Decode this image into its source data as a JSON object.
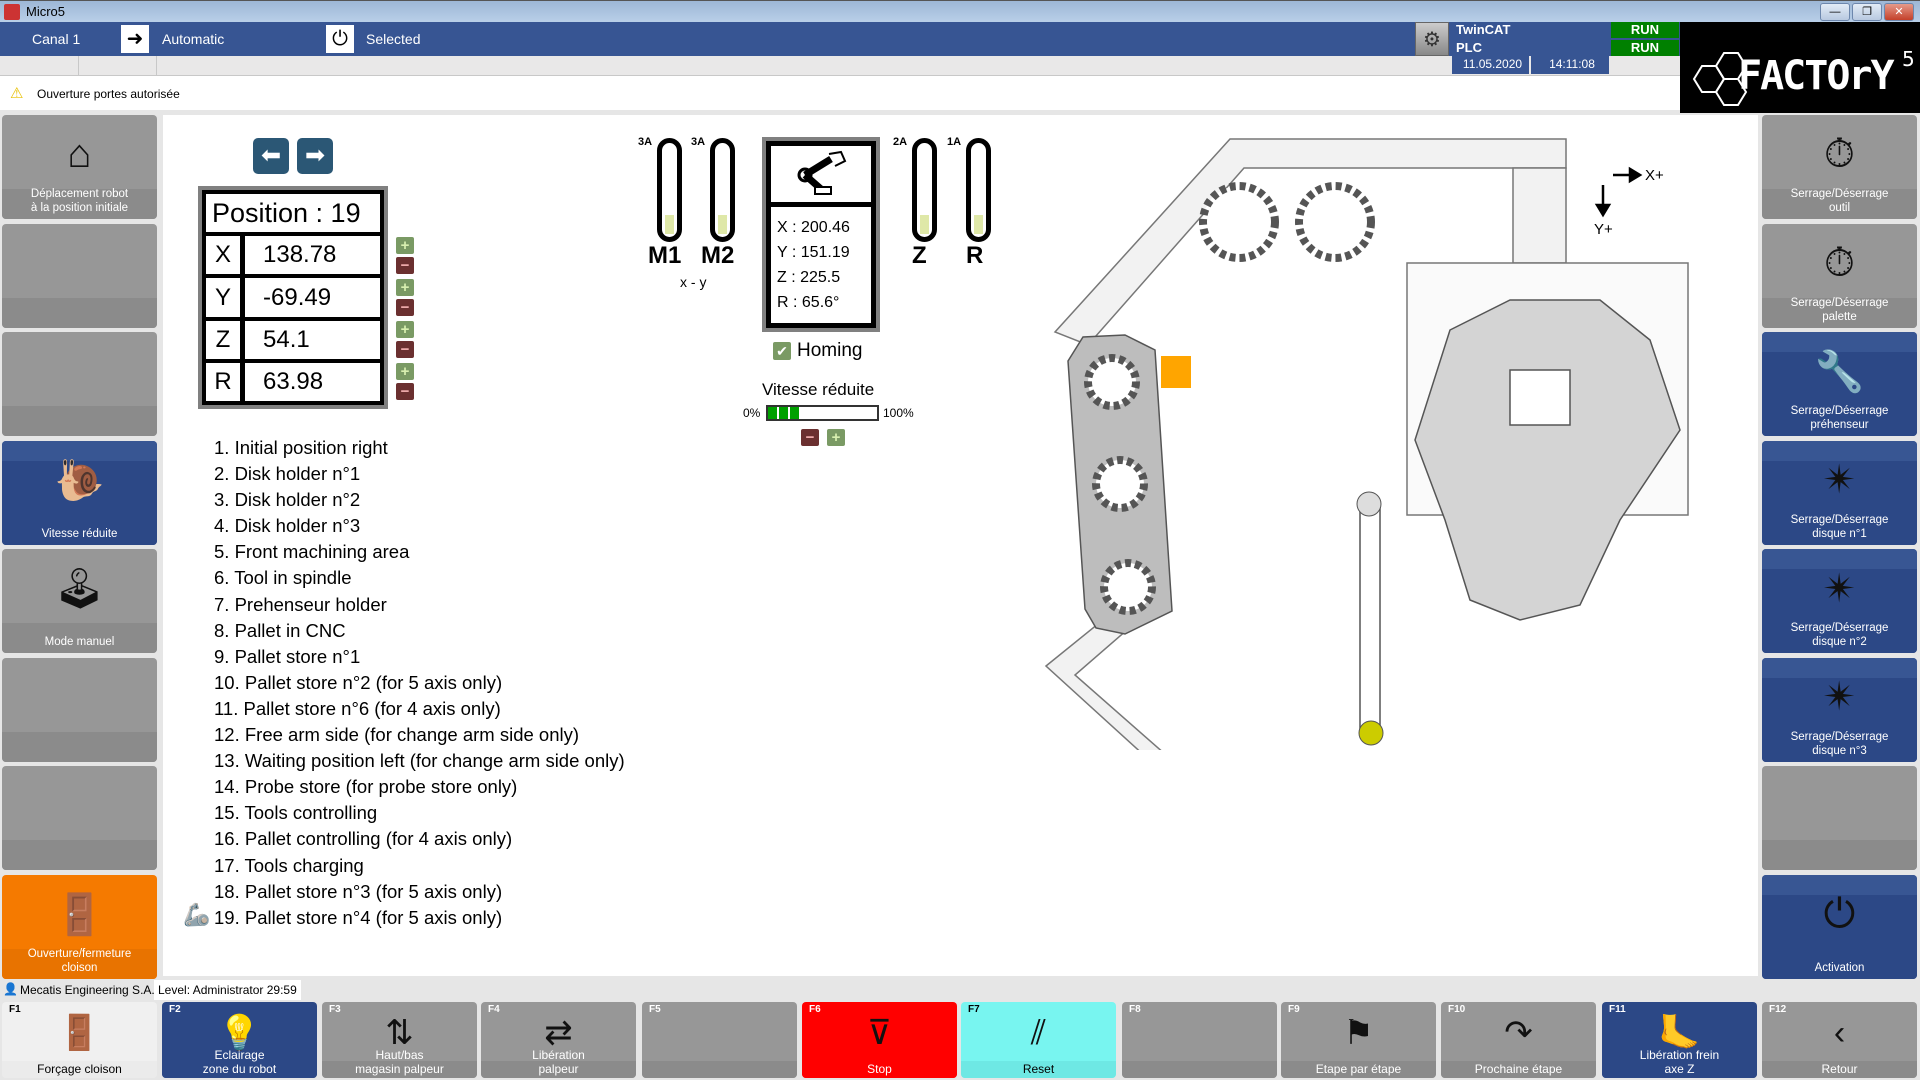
{
  "window": {
    "title": "Micro5",
    "controls": [
      "minimize",
      "restore",
      "close"
    ]
  },
  "topbar": {
    "channel": "Canal 1",
    "mode": "Automatic",
    "mode_icon": "enter-arrow-icon",
    "state": "Selected",
    "state_icon": "power-icon"
  },
  "plc_status": {
    "rows": [
      {
        "label": "TwinCAT",
        "status": "RUN"
      },
      {
        "label": "PLC",
        "status": "RUN"
      }
    ],
    "date": "11.05.2020",
    "time": "14:11:08",
    "status_color": "#008000"
  },
  "warning": {
    "text": "Ouverture portes autorisée",
    "icon": "warning-icon"
  },
  "logo": {
    "text": "FACTORY",
    "superscript": "5"
  },
  "left_sidebar": [
    {
      "label": "Déplacement robot\nà la position initiale",
      "icon": "home-arrows-icon",
      "style": "gray"
    },
    {
      "label": "",
      "icon": "",
      "style": "gray"
    },
    {
      "label": "",
      "icon": "",
      "style": "gray"
    },
    {
      "label": "Vitesse réduite",
      "icon": "snail-icon",
      "style": "blue"
    },
    {
      "label": "Mode manuel",
      "icon": "joystick-icon",
      "style": "gray"
    },
    {
      "label": "",
      "icon": "",
      "style": "gray"
    },
    {
      "label": "",
      "icon": "",
      "style": "gray"
    },
    {
      "label": "Ouverture/fermeture\ncloison",
      "icon": "door-icon",
      "style": "orange"
    }
  ],
  "right_sidebar": [
    {
      "label": "Serrage/Déserrage\noutil",
      "icon": "tool-clamp-timer-icon",
      "style": "gray"
    },
    {
      "label": "Serrage/Déserrage\npalette",
      "icon": "pallet-clamp-timer-icon",
      "style": "gray"
    },
    {
      "label": "Serrage/Déserrage\npréhenseur",
      "icon": "wrench-clamp-icon",
      "style": "blue"
    },
    {
      "label": "Serrage/Déserrage\ndisque n°1",
      "icon": "star-clamp-icon",
      "style": "blue"
    },
    {
      "label": "Serrage/Déserrage\ndisque n°2",
      "icon": "star-clamp-icon",
      "style": "blue"
    },
    {
      "label": "Serrage/Déserrage\ndisque n°3",
      "icon": "star-clamp-icon",
      "style": "blue"
    },
    {
      "label": "",
      "icon": "",
      "style": "gray"
    },
    {
      "label": "Activation",
      "icon": "power-icon",
      "style": "blue"
    }
  ],
  "position": {
    "title": "Position : 19",
    "axes": [
      {
        "name": "X",
        "value": "138.78"
      },
      {
        "name": "Y",
        "value": "-69.49"
      },
      {
        "name": "Z",
        "value": "54.1"
      },
      {
        "name": "R",
        "value": "63.98"
      }
    ]
  },
  "motors": [
    {
      "name": "M1",
      "current": "3A",
      "fill": 0.2
    },
    {
      "name": "M2",
      "current": "3A",
      "fill": 0.2
    },
    {
      "name": "Z",
      "current": "2A",
      "fill": 0.2
    },
    {
      "name": "R",
      "current": "1A",
      "fill": 0.2
    }
  ],
  "motors_caption": "x - y",
  "robot": {
    "icon": "robot-arm-icon",
    "coords": [
      "X : 200.46",
      "Y : 151.19",
      "Z : 225.5",
      "R : 65.6°"
    ],
    "homing_label": "Homing",
    "homing_checked": true
  },
  "speed": {
    "title": "Vitesse réduite",
    "min_label": "0%",
    "max_label": "100%",
    "value_percent": 30,
    "bar_color": "#00a000"
  },
  "positions_list": [
    "1. Initial position right",
    "2. Disk holder n°1",
    "3. Disk holder n°2",
    "4. Disk holder n°3",
    "5. Front machining area",
    "6. Tool in spindle",
    "7. Prehenseur holder",
    "8. Pallet in CNC",
    "9. Pallet store n°1",
    "10. Pallet store n°2 (for 5 axis only)",
    "11. Pallet store n°6 (for 4 axis only)",
    "12. Free arm side (for change arm side only)",
    "13. Waiting position left (for change arm side only)",
    "14. Probe store (for probe store only)",
    "15. Tools controlling",
    "16. Pallet controlling (for 4 axis only)",
    "17. Tools charging",
    "18. Pallet store n°3 (for 5 axis only)",
    "19. Pallet store n°4 (for 5 axis only)"
  ],
  "current_position_index": 19,
  "layout_view": {
    "x_axis_label": "X+",
    "y_axis_label": "Y+",
    "marker_color": "#ffa500",
    "carriage_color": "#cccc00"
  },
  "status": {
    "company": "Mecatis Engineering S.A.",
    "level": "Level: Administrator 29:59"
  },
  "fkeys": [
    {
      "key": "F1",
      "label": "Forçage cloison",
      "style": "white",
      "icon": "door-timer-hand-icon"
    },
    {
      "key": "F2",
      "label": "Eclairage\nzone du robot",
      "style": "blue",
      "icon": "light-bulb-icon"
    },
    {
      "key": "F3",
      "label": "Haut/bas\nmagasin palpeur",
      "style": "gray",
      "icon": "probe-updown-icon"
    },
    {
      "key": "F4",
      "label": "Libération\npalpeur",
      "style": "gray",
      "icon": "probe-release-icon"
    },
    {
      "key": "F5",
      "label": "",
      "style": "gray",
      "icon": ""
    },
    {
      "key": "F6",
      "label": "Stop",
      "style": "red",
      "icon": "stop-icon"
    },
    {
      "key": "F7",
      "label": "Reset",
      "style": "cyan",
      "icon": "reset-icon"
    },
    {
      "key": "F8",
      "label": "",
      "style": "gray",
      "icon": ""
    },
    {
      "key": "F9",
      "label": "Etape par étape",
      "style": "gray",
      "icon": "step-flag-icon"
    },
    {
      "key": "F10",
      "label": "Prochaine étape",
      "style": "gray",
      "icon": "next-step-icon"
    },
    {
      "key": "F11",
      "label": "Libération frein\naxe Z",
      "style": "blue",
      "icon": "brake-release-icon"
    },
    {
      "key": "F12",
      "label": "Retour",
      "style": "gray",
      "icon": "back-icon"
    }
  ]
}
